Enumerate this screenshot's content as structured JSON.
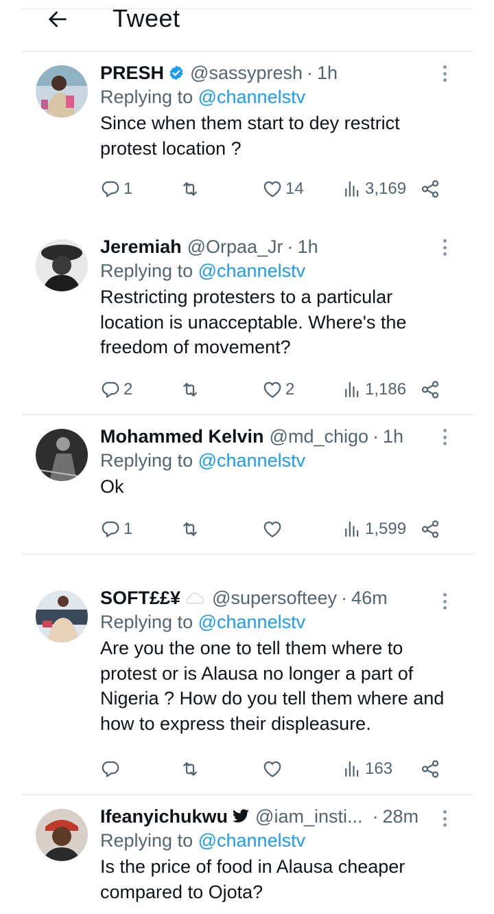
{
  "header": {
    "title": "Tweet",
    "back_icon": "arrow-left-icon"
  },
  "colors": {
    "link": "#1d9bf0",
    "muted": "#536471",
    "text": "#0f1419",
    "verified": "#1d9bf0"
  },
  "tweets": [
    {
      "name": "PRESH",
      "verified": true,
      "handle": "@sassypresh",
      "dot": "·",
      "time": "1h",
      "replying_prefix": "Replying to ",
      "replying_to": "@channelstv",
      "text": "Since when them start to dey restrict protest location ?",
      "replies": "1",
      "retweets": "",
      "likes": "14",
      "views": "3,169"
    },
    {
      "name": "Jeremiah",
      "verified": false,
      "handle": "@Orpaa_Jr",
      "dot": "·",
      "time": "1h",
      "replying_prefix": "Replying to ",
      "replying_to": "@channelstv",
      "text": "Restricting protesters to a particular location is unacceptable. Where's the freedom of movement?",
      "replies": "2",
      "retweets": "",
      "likes": "2",
      "views": "1,186"
    },
    {
      "name": "Mohammed Kelvin",
      "verified": false,
      "handle": "@md_chigo",
      "dot": "·",
      "time": "1h",
      "replying_prefix": "Replying to ",
      "replying_to": "@channelstv",
      "text": "Ok",
      "replies": "1",
      "retweets": "",
      "likes": "",
      "views": "1,599"
    },
    {
      "name": "SOFT££¥",
      "verified": false,
      "handle": "@supersofteey",
      "dot": "·",
      "time": "46m",
      "replying_prefix": "Replying to ",
      "replying_to": "@channelstv",
      "text": "Are you the one to tell them where to protest or is Alausa no longer a part of Nigeria ? How do you tell them where and how to express their displeasure.",
      "replies": "",
      "retweets": "",
      "likes": "",
      "views": "163"
    },
    {
      "name": "Ifeanyichukwu",
      "verified": false,
      "handle": "@iam_insti...",
      "dot": "·",
      "time": "28m",
      "replying_prefix": "Replying to ",
      "replying_to": "@channelstv",
      "text": "Is the price of food in Alausa cheaper compared to Ojota?",
      "replies": "",
      "retweets": "",
      "likes": "",
      "views": ""
    }
  ]
}
